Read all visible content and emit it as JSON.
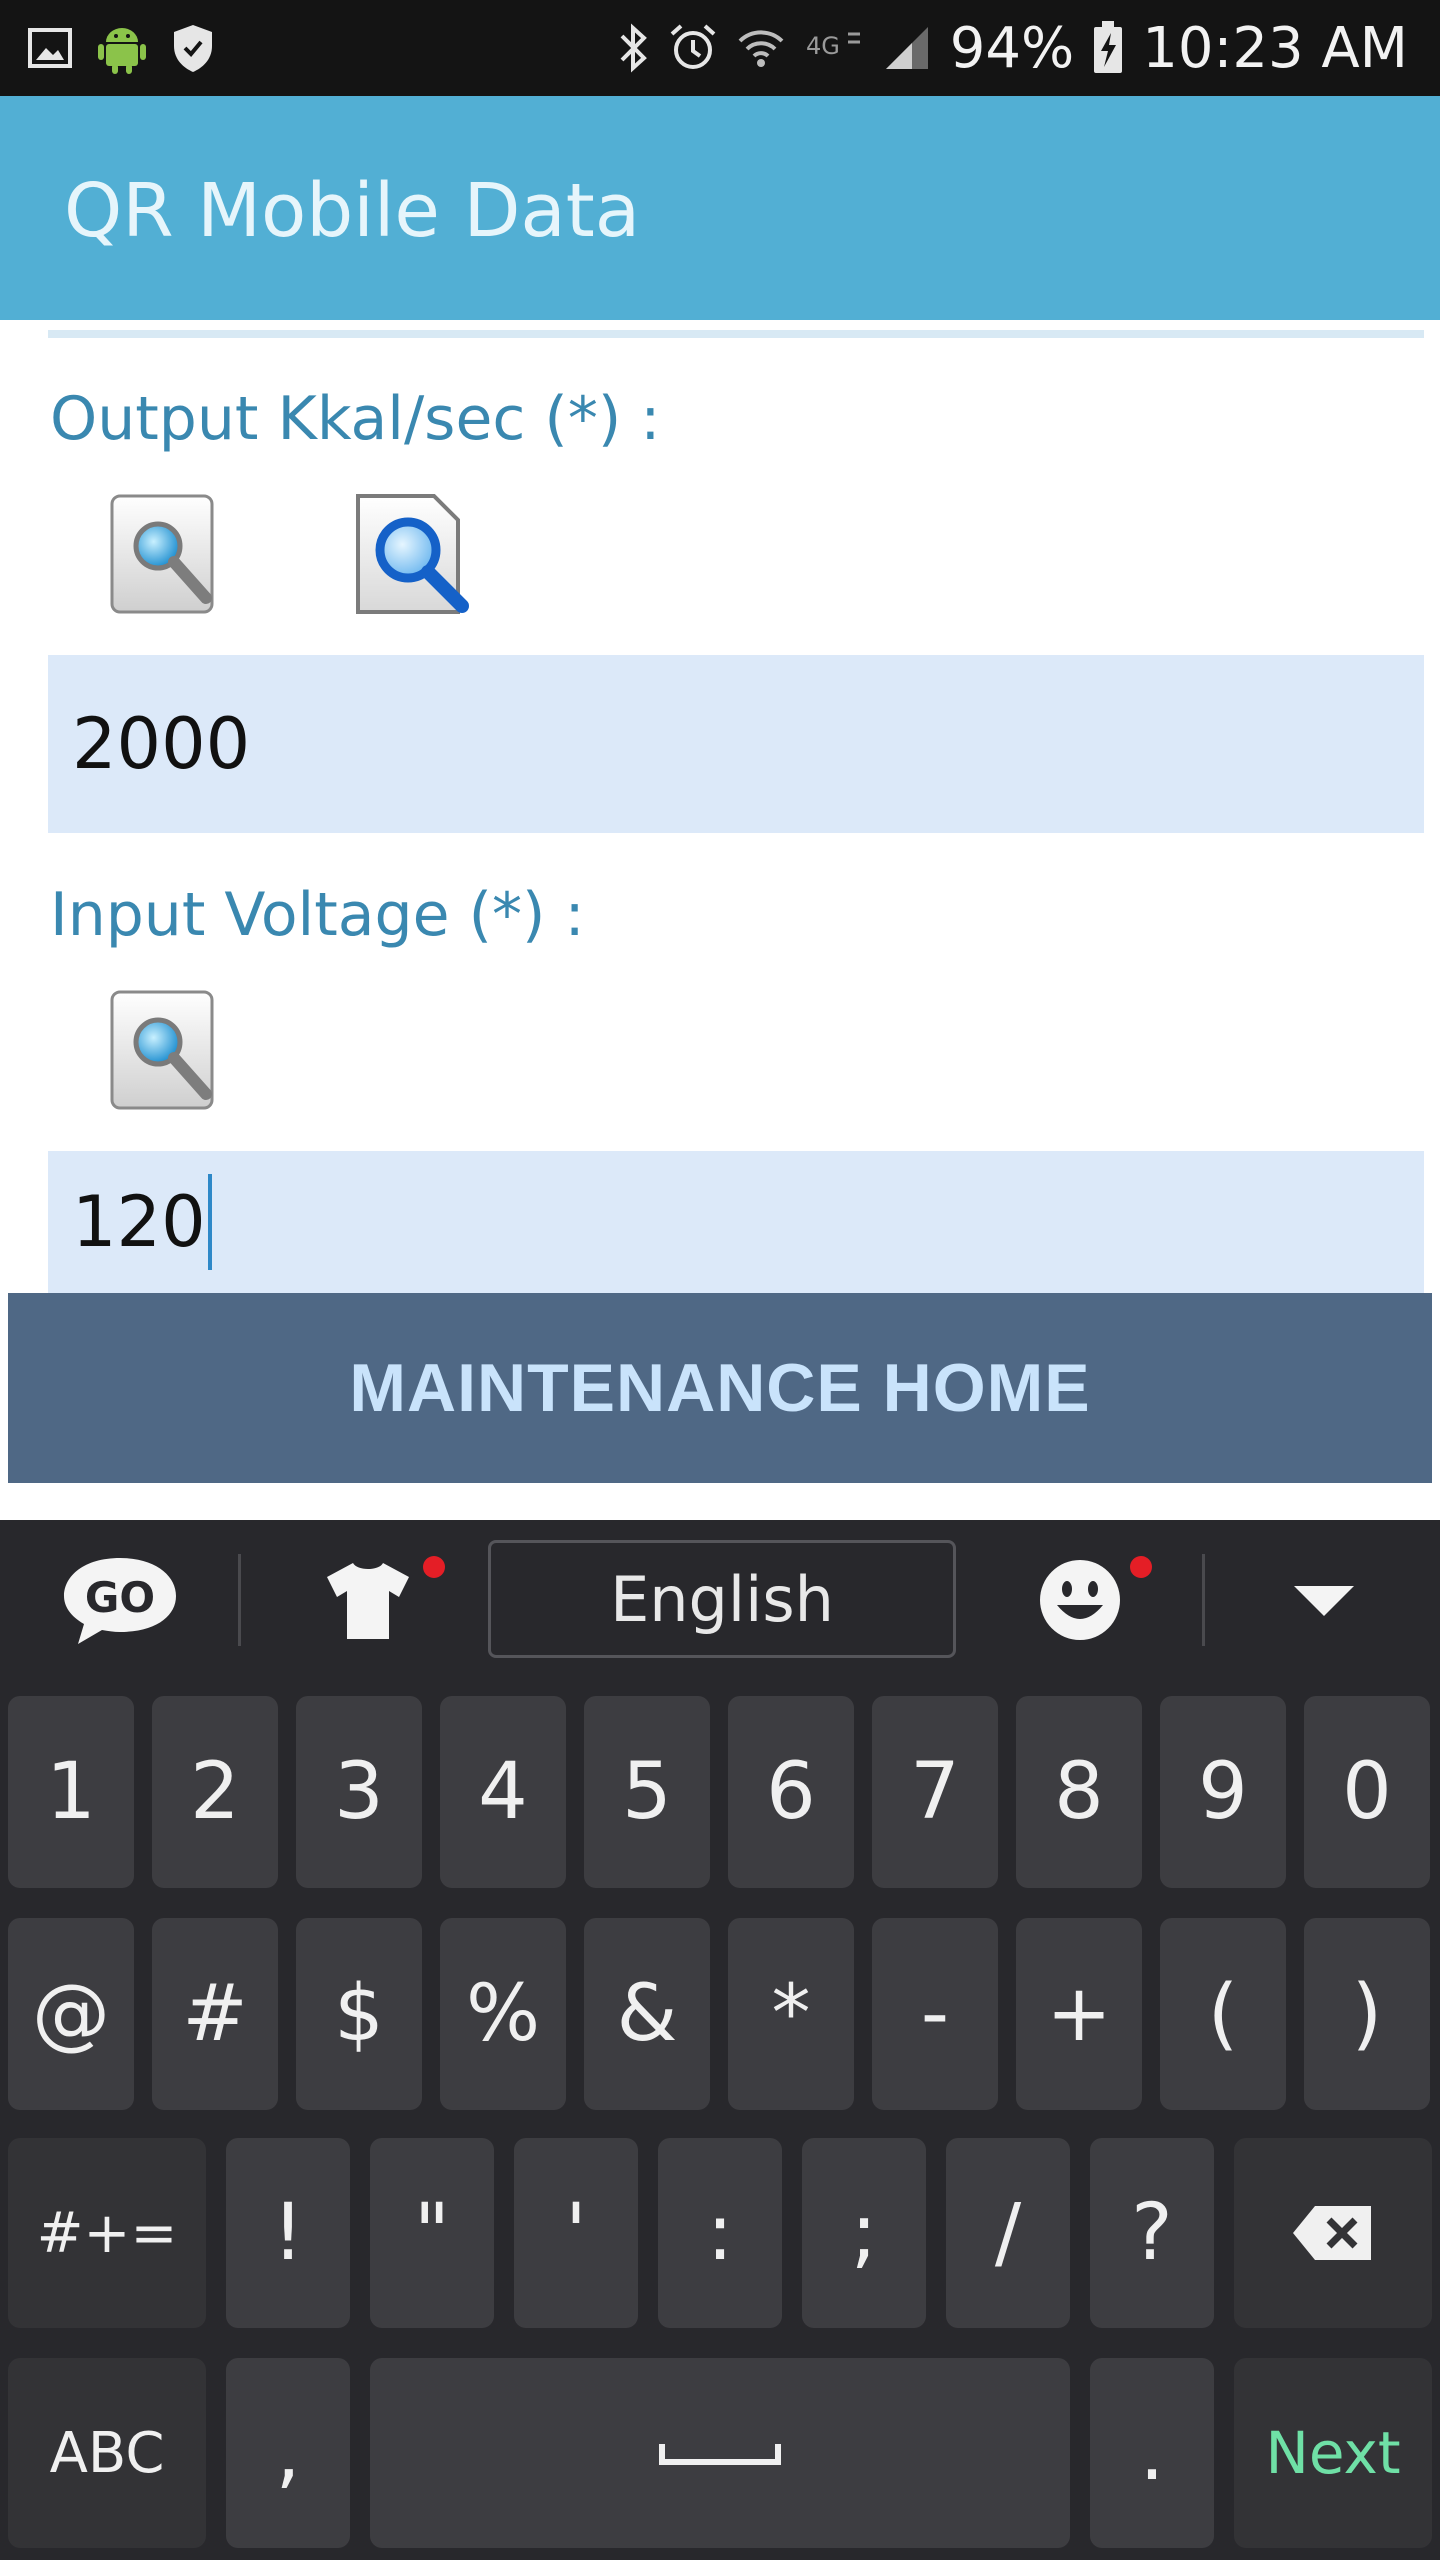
{
  "status_bar": {
    "battery": "94%",
    "time": "10:23 AM",
    "left_icons": [
      "image-icon",
      "android-icon",
      "shield-icon"
    ],
    "right_icons": [
      "bluetooth-icon",
      "alarm-icon",
      "wifi-icon",
      "lte-icon",
      "signal-icon",
      "battery-charging-icon"
    ]
  },
  "app_bar": {
    "title": "QR Mobile Data"
  },
  "form": {
    "output_label": "Output Kkal/sec (*) :",
    "output_value": "2000",
    "input_label": "Input Voltage (*) :",
    "input_value": "120"
  },
  "maintenance_button": "MAINTENANCE HOME",
  "keyboard": {
    "language": "English",
    "toolbar_icons": [
      "go-logo-icon",
      "theme-shirt-icon",
      "emoji-icon",
      "collapse-chevron-icon"
    ],
    "row1": [
      "1",
      "2",
      "3",
      "4",
      "5",
      "6",
      "7",
      "8",
      "9",
      "0"
    ],
    "row2": [
      "@",
      "#",
      "$",
      "%",
      "&",
      "*",
      "-",
      "+",
      "(",
      ")"
    ],
    "row3_mode": "#+=",
    "row3": [
      "!",
      "\"",
      "'",
      ":",
      ";",
      "/",
      "?"
    ],
    "row4_mode": "ABC",
    "row4_comma": ",",
    "row4_period": ".",
    "next_label": "Next"
  },
  "colors": {
    "app_bar": "#52afd4",
    "field_label": "#3a88b0",
    "input_bg": "#dce9f9",
    "button_bg": "#4f6885",
    "button_text": "#c9e3fb",
    "keyboard_bg": "#28282c",
    "key_bg": "#3d3d41",
    "next_text": "#6fe0a6"
  }
}
